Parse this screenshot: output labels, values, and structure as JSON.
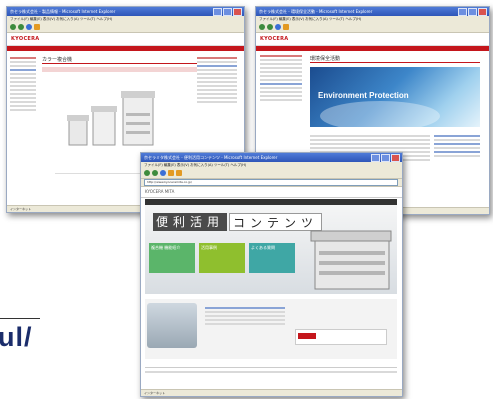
{
  "windows": {
    "left": {
      "title": "京セラ株式会社 - 製品情報 - Microsoft Internet Explorer",
      "menu": "ファイル(F)  編集(E)  表示(V)  お気に入り(A)  ツール(T)  ヘルプ(H)",
      "logo": "KYOCERA",
      "heading": "カラー複合機",
      "status": "インターネット"
    },
    "right": {
      "title": "京セラ株式会社 - 環境保全活動 - Microsoft Internet Explorer",
      "menu": "ファイル(F)  編集(E)  表示(V)  お気に入り(A)  ツール(T)  ヘルプ(H)",
      "logo": "KYOCERA",
      "heading": "環境保全活動",
      "banner": "Environment Protection",
      "status": "インターネット"
    },
    "front": {
      "title": "京セラミタ株式会社 - 便利活用コンテンツ - Microsoft Internet Explorer",
      "menu": "ファイル(F)  編集(E)  表示(V)  お気に入り(A)  ツール(T)  ヘルプ(H)",
      "address": "http://www.kyoceramita.co.jp/",
      "site_logo": "KYOCERA MITA",
      "hero_label": "便利活用",
      "hero_label2": "コンテンツ",
      "card1": "複合機 機能紹介",
      "card2": "活用事例",
      "card3": "よくある質問",
      "status": "インターネット"
    }
  },
  "heading": "ul/"
}
